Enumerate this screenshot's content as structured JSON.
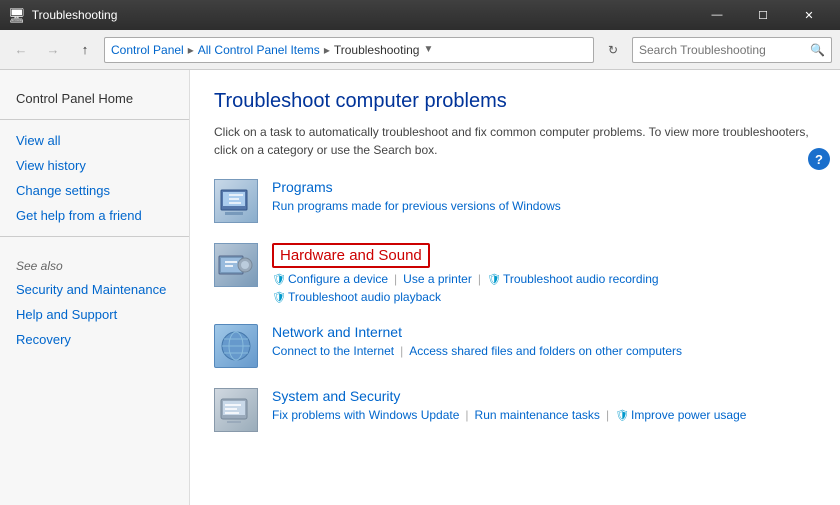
{
  "titlebar": {
    "icon": "🖥",
    "title": "Troubleshooting",
    "minimize": "—",
    "maximize": "☐",
    "close": "✕"
  },
  "addressbar": {
    "breadcrumb": [
      "Control Panel",
      "All Control Panel Items",
      "Troubleshooting"
    ],
    "search_placeholder": "Search Troubleshooting",
    "search_icon": "🔍"
  },
  "sidebar": {
    "control_panel_home": "Control Panel Home",
    "view_all": "View all",
    "view_history": "View history",
    "change_settings": "Change settings",
    "get_help": "Get help from a friend",
    "see_also": "See also",
    "security": "Security and Maintenance",
    "help_support": "Help and Support",
    "recovery": "Recovery"
  },
  "content": {
    "title": "Troubleshoot computer problems",
    "description": "Click on a task to automatically troubleshoot and fix common computer problems. To view more troubleshooters, click on a category or use the Search box.",
    "categories": [
      {
        "name": "Programs",
        "subtitle": "Run programs made for previous versions of Windows",
        "links": [],
        "highlighted": false
      },
      {
        "name": "Hardware and Sound",
        "subtitle": "",
        "links": [
          "Configure a device",
          "Use a printer",
          "Troubleshoot audio recording",
          "Troubleshoot audio playback"
        ],
        "highlighted": true
      },
      {
        "name": "Network and Internet",
        "subtitle": "",
        "links": [
          "Connect to the Internet",
          "Access shared files and folders on other computers"
        ],
        "highlighted": false
      },
      {
        "name": "System and Security",
        "subtitle": "",
        "links": [
          "Fix problems with Windows Update",
          "Run maintenance tasks",
          "Improve power usage"
        ],
        "highlighted": false
      }
    ]
  }
}
